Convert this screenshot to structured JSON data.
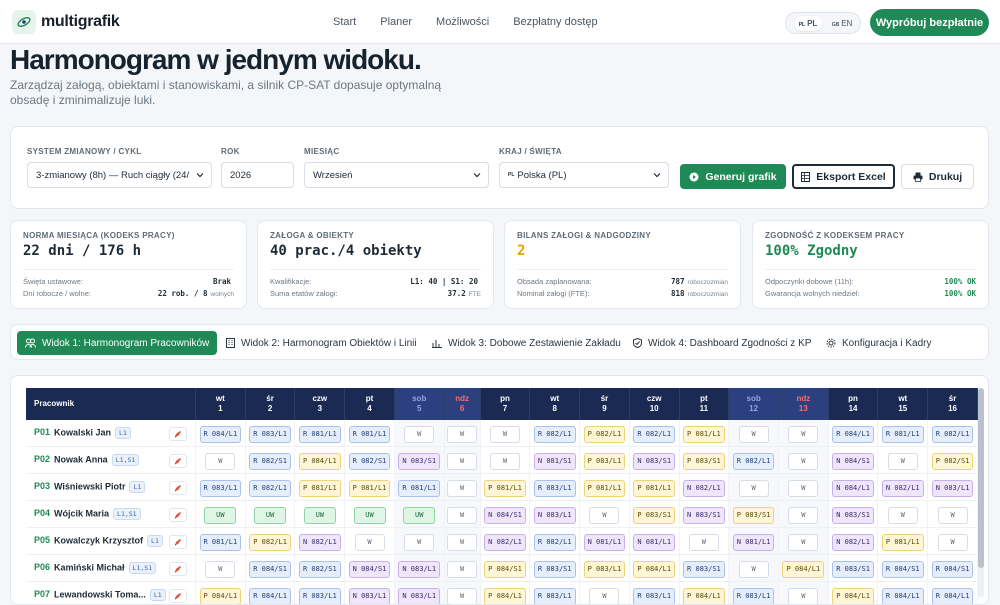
{
  "brand": {
    "name": "multigrafik",
    "color": "#1f8a55"
  },
  "nav": {
    "links": [
      "Start",
      "Planer",
      "Możliwości",
      "Bezpłatny dostęp"
    ]
  },
  "lang": {
    "pl_code": "PL",
    "pl_label": "PL",
    "en_code": "GB",
    "en_label": "EN"
  },
  "cta": "Wypróbuj bezpłatnie",
  "hero": {
    "title": "Harmonogram w jednym widoku.",
    "subtitle": "Zarządzaj załogą, obiektami i stanowiskami, a silnik CP-SAT dopasuje optymalną obsadę i zminimalizuje luki."
  },
  "controls": {
    "system_label": "SYSTEM ZMIANOWY / CYKL",
    "system_value": "3-zmianowy (8h) — Ruch ciągły (24/",
    "year_label": "ROK",
    "year_value": "2026",
    "month_label": "MIESIĄC",
    "month_value": "Wrzesień",
    "country_label": "KRAJ / ŚWIĘTA",
    "country_flag": "PL",
    "country_value": "Polska (PL)",
    "generate": "Generuj grafik",
    "export": "Eksport Excel",
    "print": "Drukuj"
  },
  "kpis": [
    {
      "title": "NORMA MIESIĄCA (KODEKS PRACY)",
      "value": "22 dni / 176 h",
      "r1_label": "Święta ustawowe:",
      "r1_value": "Brak",
      "r1_unit": "",
      "r2_label": "Dni robocze / wolne:",
      "r2_value": "22 rob. / 8",
      "r2_unit": "wolnych"
    },
    {
      "title": "ZAŁOGA & OBIEKTY",
      "value": "40 prac./4 obiekty",
      "r1_label": "Kwalifikacje:",
      "r1_value": "L1: 40 | S1: 20",
      "r1_unit": "",
      "r2_label": "Suma etatów załogi:",
      "r2_value": "37.2",
      "r2_unit": "FTE"
    },
    {
      "title": "BILANS ZAŁOGI & NADGODZINY",
      "value": "2",
      "r1_label": "Obsada zaplanowana:",
      "r1_value": "787",
      "r1_unit": "roboczozmian",
      "r2_label": "Nominał załogi (FTE):",
      "r2_value": "818",
      "r2_unit": "roboczozmian"
    },
    {
      "title": "ZGODNOŚĆ Z KODEKSEM PRACY",
      "value": "100% Zgodny",
      "r1_label": "Odpoczynki dobowe (11h):",
      "r1_value": "100% OK",
      "r1_unit": "",
      "r2_label": "Gwarancja wolnych niedziel:",
      "r2_value": "100% OK",
      "r2_unit": ""
    }
  ],
  "tabs": [
    "Widok 1: Harmonogram Pracowników",
    "Widok 2: Harmonogram Obiektów i Linii",
    "Widok 3: Dobowe Zestawienie Zakładu",
    "Widok 4: Dashboard Zgodności z KP",
    "Konfiguracja i Kadry"
  ],
  "table": {
    "employee_header": "Pracownik",
    "days": [
      {
        "dn": "wt",
        "d": "1",
        "t": "n"
      },
      {
        "dn": "śr",
        "d": "2",
        "t": "n"
      },
      {
        "dn": "czw",
        "d": "3",
        "t": "n"
      },
      {
        "dn": "pt",
        "d": "4",
        "t": "n"
      },
      {
        "dn": "sob",
        "d": "5",
        "t": "we"
      },
      {
        "dn": "ndz",
        "d": "6",
        "t": "hol"
      },
      {
        "dn": "pn",
        "d": "7",
        "t": "n"
      },
      {
        "dn": "wt",
        "d": "8",
        "t": "n"
      },
      {
        "dn": "śr",
        "d": "9",
        "t": "n"
      },
      {
        "dn": "czw",
        "d": "10",
        "t": "n"
      },
      {
        "dn": "pt",
        "d": "11",
        "t": "n"
      },
      {
        "dn": "sob",
        "d": "12",
        "t": "we"
      },
      {
        "dn": "ndz",
        "d": "13",
        "t": "hol"
      },
      {
        "dn": "pn",
        "d": "14",
        "t": "n"
      },
      {
        "dn": "wt",
        "d": "15",
        "t": "n"
      },
      {
        "dn": "śr",
        "d": "16",
        "t": "n"
      }
    ],
    "rows": [
      {
        "id": "P01",
        "name": "Kowalski Jan",
        "quals": "L1",
        "cells": [
          "R 084/L1",
          "R 083/L1",
          "R 081/L1",
          "R 081/L1",
          "W",
          "W",
          "W",
          "R 082/L1",
          "P 082/L1",
          "R 082/L1",
          "P 081/L1",
          "W",
          "W",
          "R 084/L1",
          "R 081/L1",
          "R 082/L1"
        ]
      },
      {
        "id": "P02",
        "name": "Nowak Anna",
        "quals": "L1,S1",
        "cells": [
          "W",
          "R 082/S1",
          "P 084/L1",
          "R 082/S1",
          "N 083/S1",
          "W",
          "W",
          "N 081/S1",
          "P 083/L1",
          "N 083/S1",
          "P 083/S1",
          "R 082/L1",
          "W",
          "N 084/S1",
          "W",
          "P 082/S1"
        ]
      },
      {
        "id": "P03",
        "name": "Wiśniewski Piotr",
        "quals": "L1",
        "cells": [
          "R 083/L1",
          "R 082/L1",
          "P 081/L1",
          "P 081/L1",
          "R 081/L1",
          "W",
          "P 081/L1",
          "R 083/L1",
          "P 081/L1",
          "P 081/L1",
          "N 082/L1",
          "W",
          "W",
          "N 084/L1",
          "N 082/L1",
          "N 083/L1"
        ]
      },
      {
        "id": "P04",
        "name": "Wójcik Maria",
        "quals": "L1,S1",
        "cells": [
          "UW",
          "UW",
          "UW",
          "UW",
          "UW",
          "W",
          "N 084/S1",
          "N 083/L1",
          "W",
          "P 083/S1",
          "N 083/S1",
          "P 083/S1",
          "W",
          "N 083/S1",
          "W",
          "W"
        ]
      },
      {
        "id": "P05",
        "name": "Kowalczyk Krzysztof",
        "quals": "L1",
        "cells": [
          "R 081/L1",
          "P 082/L1",
          "N 082/L1",
          "W",
          "W",
          "W",
          "N 082/L1",
          "R 082/L1",
          "N 081/L1",
          "N 081/L1",
          "W",
          "N 081/L1",
          "W",
          "N 082/L1",
          "P 081/L1",
          "W"
        ]
      },
      {
        "id": "P06",
        "name": "Kamiński Michał",
        "quals": "L1,S1",
        "cells": [
          "W",
          "R 084/S1",
          "R 082/S1",
          "N 084/S1",
          "N 083/L1",
          "W",
          "P 084/S1",
          "R 083/S1",
          "P 083/L1",
          "P 084/L1",
          "R 083/S1",
          "W",
          "P 084/L1",
          "R 083/S1",
          "R 084/S1",
          "R 084/S1"
        ]
      },
      {
        "id": "P07",
        "name": "Lewandowski Toma...",
        "quals": "L1",
        "cells": [
          "P 084/L1",
          "R 084/L1",
          "R 083/L1",
          "N 083/L1",
          "N 083/L1",
          "W",
          "P 084/L1",
          "R 083/L1",
          "W",
          "R 083/L1",
          "P 084/L1",
          "R 083/L1",
          "W",
          "P 084/L1",
          "R 084/L1",
          "R 084/L1"
        ]
      }
    ]
  },
  "colors": {
    "green": "#1f8a55",
    "navy": "#1a2a52",
    "amber": "#e3a008",
    "ok": "#1f8a55"
  }
}
